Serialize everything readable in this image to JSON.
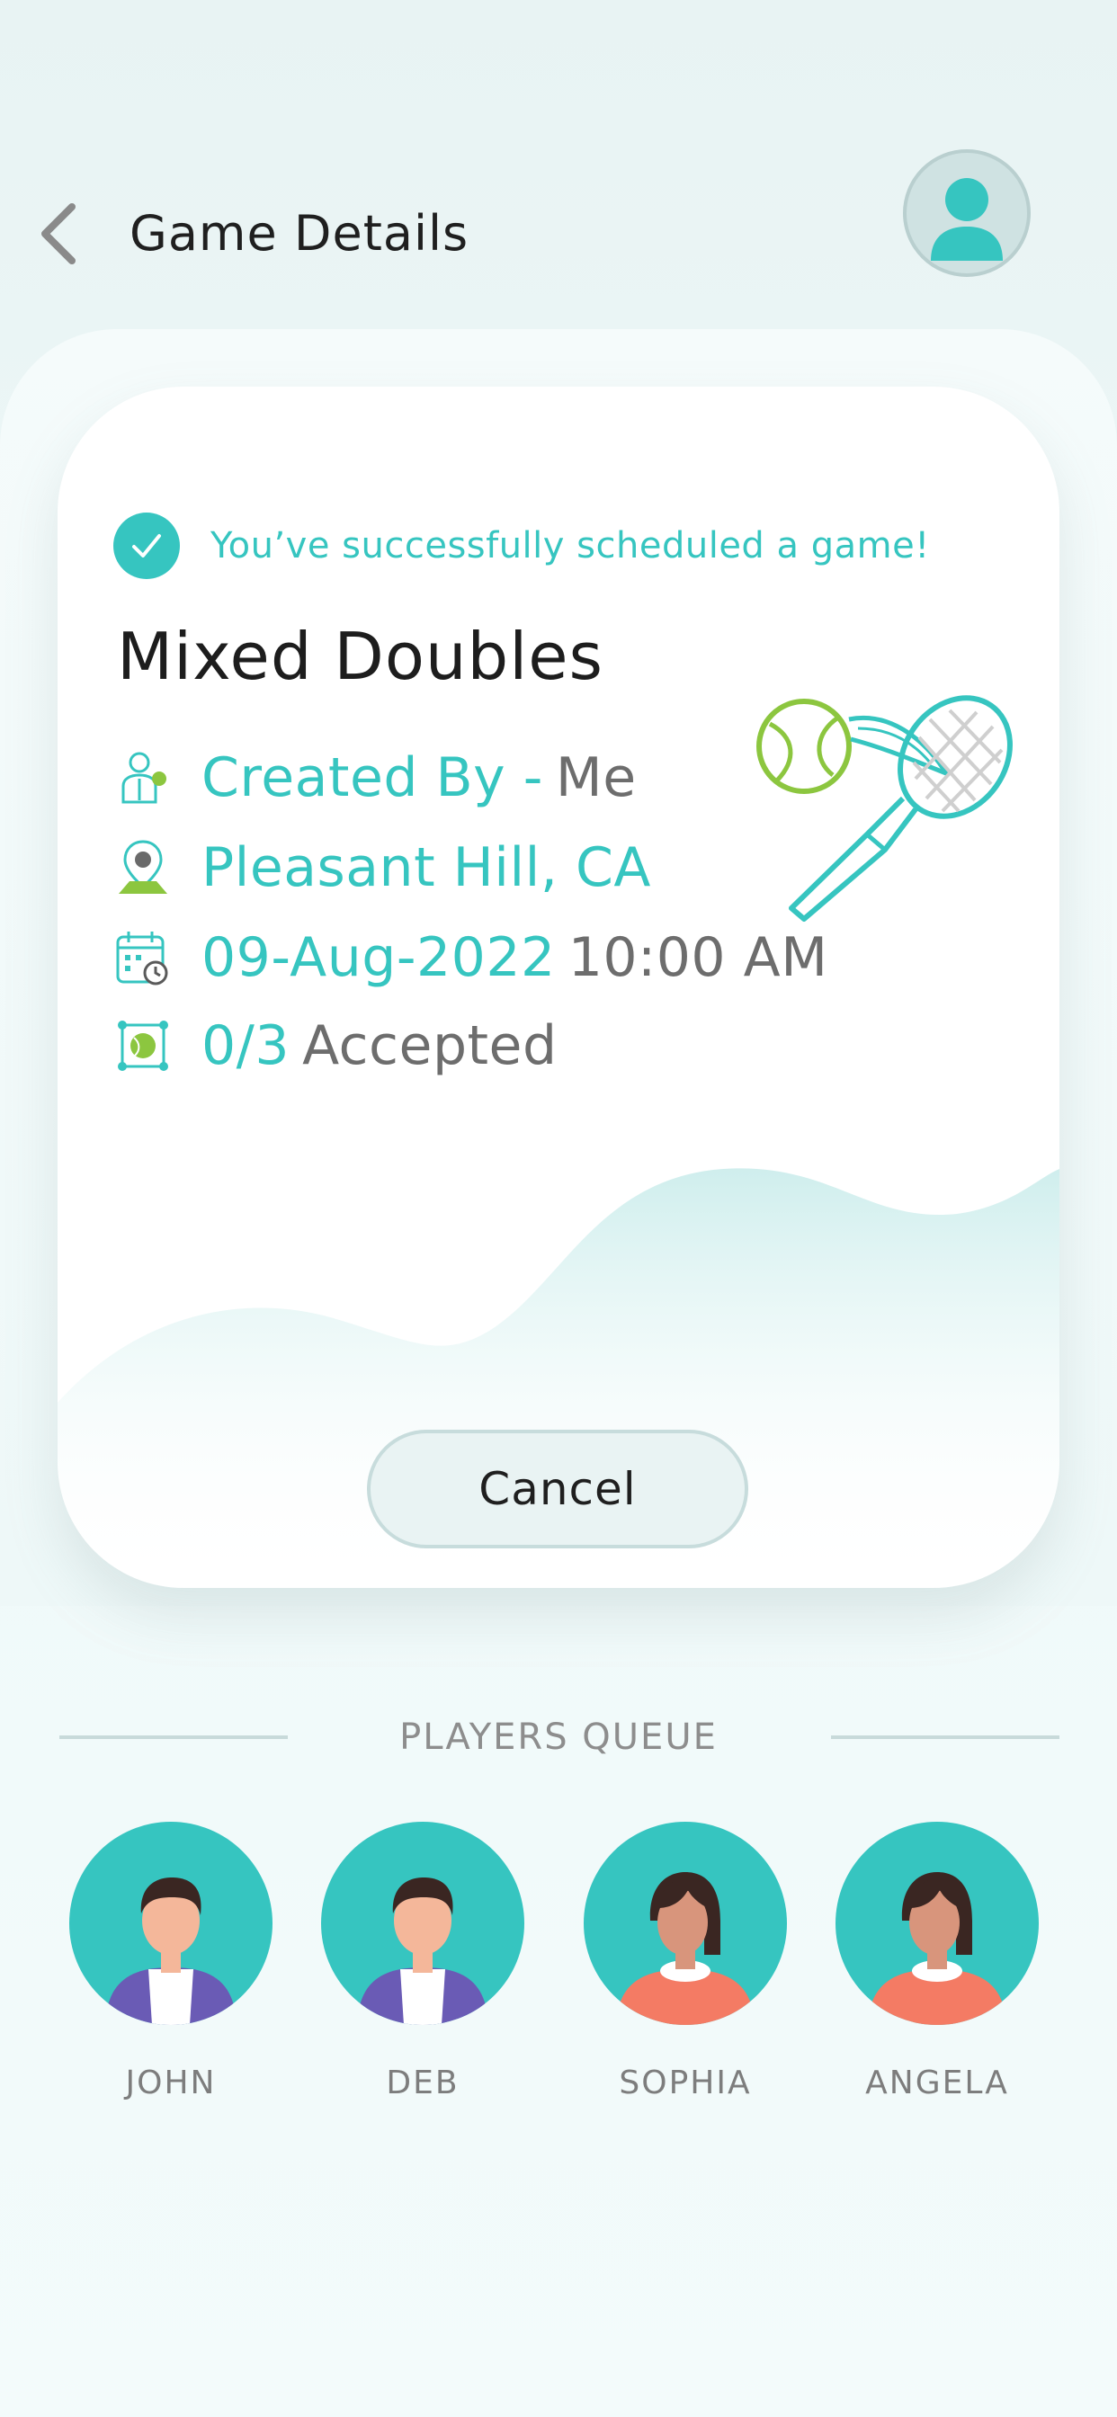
{
  "header": {
    "title": "Game Details",
    "back_icon": "chevron-left-icon",
    "profile_icon": "user-avatar-icon"
  },
  "card": {
    "success_message": "You’ve successfully scheduled a game!",
    "game_title": "Mixed Doubles",
    "created_by_label": "Created By -",
    "created_by_value": "Me",
    "location": "Pleasant Hill, CA",
    "date": "09-Aug-2022",
    "time": "10:00 AM",
    "accepted_count": "0/3",
    "accepted_label": "Accepted",
    "cancel_label": "Cancel"
  },
  "queue": {
    "title": "PLAYERS QUEUE",
    "players": [
      {
        "name": "JOHN",
        "avatar": "male"
      },
      {
        "name": "DEB",
        "avatar": "male"
      },
      {
        "name": "SOPHIA",
        "avatar": "female"
      },
      {
        "name": "ANGELA",
        "avatar": "female"
      }
    ]
  },
  "colors": {
    "accent": "#36c5c0",
    "ball_green": "#8cc63f",
    "text_dark": "#1f1f1f",
    "text_muted": "#6d6d6d",
    "background": "#eef8f8"
  }
}
